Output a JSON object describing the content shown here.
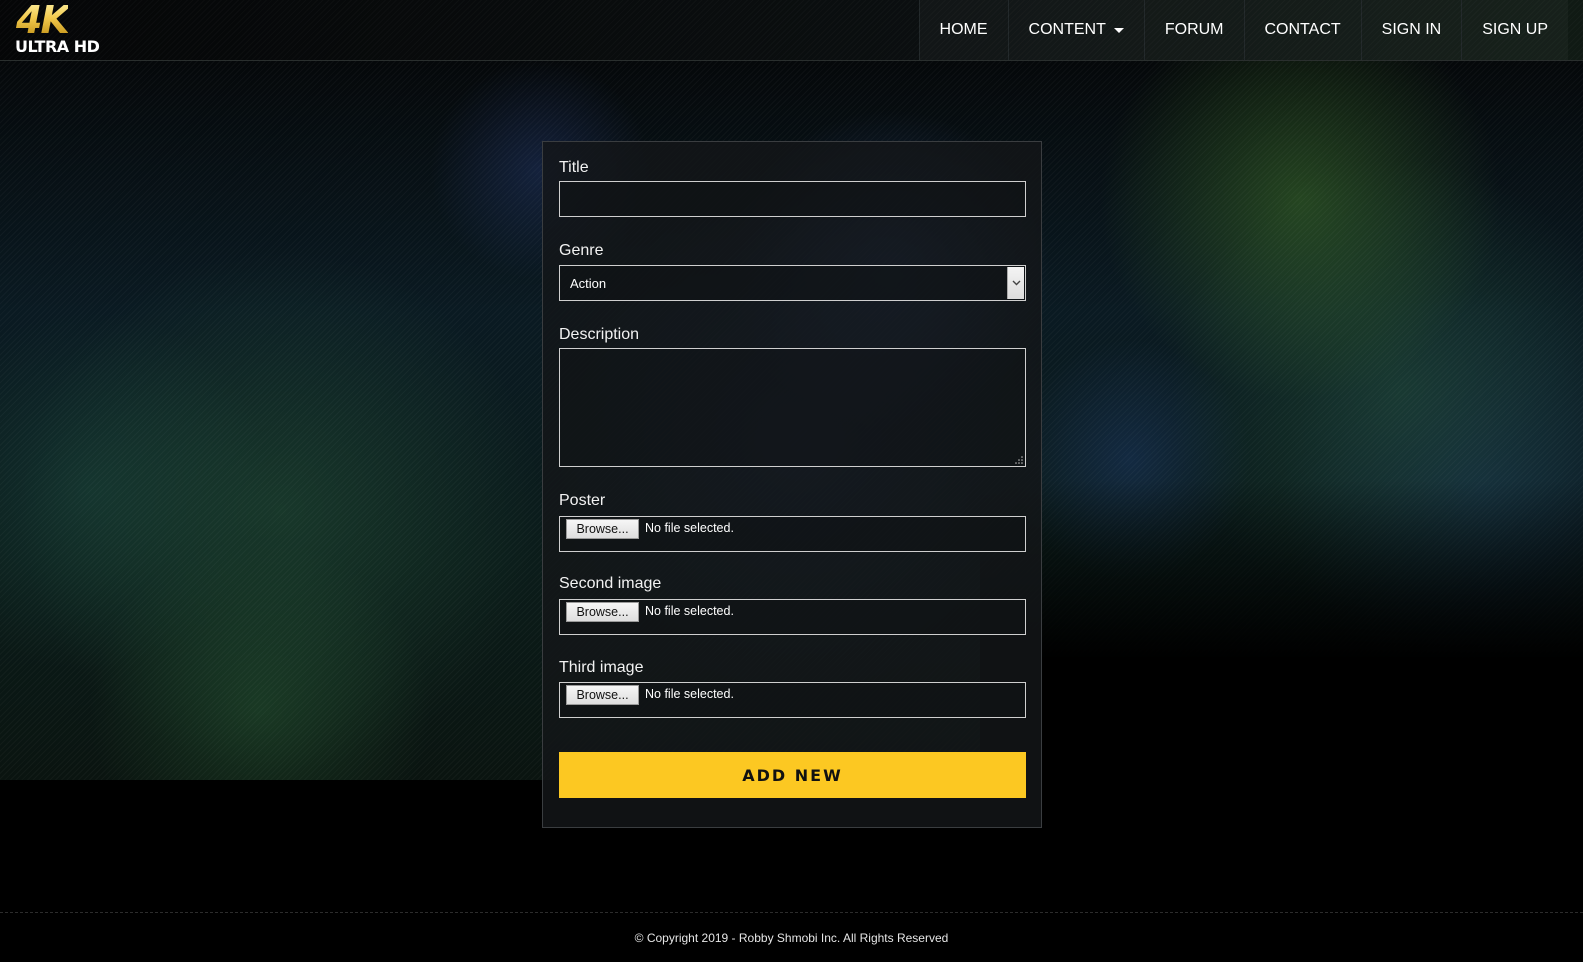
{
  "brand": {
    "logo_main": "4K",
    "logo_sub": "ULTRA HD"
  },
  "nav": {
    "items": [
      {
        "label": "HOME",
        "name": "nav-home",
        "dropdown": false
      },
      {
        "label": "CONTENT",
        "name": "nav-content",
        "dropdown": true
      },
      {
        "label": "FORUM",
        "name": "nav-forum",
        "dropdown": false
      },
      {
        "label": "CONTACT",
        "name": "nav-contact",
        "dropdown": false
      },
      {
        "label": "SIGN IN",
        "name": "nav-sign-in",
        "dropdown": false
      },
      {
        "label": "SIGN UP",
        "name": "nav-sign-up",
        "dropdown": false
      }
    ]
  },
  "form": {
    "title_label": "Title",
    "title_value": "",
    "genre_label": "Genre",
    "genre_selected": "Action",
    "description_label": "Description",
    "description_value": "",
    "poster_label": "Poster",
    "second_image_label": "Second image",
    "third_image_label": "Third image",
    "browse_label": "Browse...",
    "no_file_text": "No file selected.",
    "submit_label": "ADD NEW"
  },
  "colors": {
    "accent": "#fcc822",
    "background": "#000000"
  },
  "footer": {
    "copyright": "© Copyright 2019 - Robby Shmobi Inc. All Rights Reserved"
  }
}
